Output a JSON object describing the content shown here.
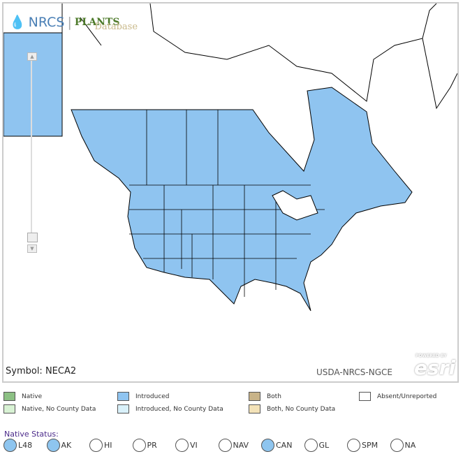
{
  "branding": {
    "agency": "NRCS",
    "product": "PLANTS",
    "product_sub": "Database"
  },
  "map": {
    "symbol_label": "Symbol: NECA2",
    "credit": "USDA-NRCS-NGCE",
    "esri_powered": "POWERED BY",
    "esri": "esri",
    "introduced_color": "#8fc4f0"
  },
  "legend": [
    {
      "label": "Native",
      "color": "#8cc084"
    },
    {
      "label": "Native, No County Data",
      "color": "#d8f2d4"
    },
    {
      "label": "Introduced",
      "color": "#8fc4f0"
    },
    {
      "label": "Introduced, No County Data",
      "color": "#d9f1fa"
    },
    {
      "label": "Both",
      "color": "#c8b388"
    },
    {
      "label": "Both, No County Data",
      "color": "#f3e2b8"
    },
    {
      "label": "Absent/Unreported",
      "color": "#ffffff"
    }
  ],
  "native_status": {
    "label": "Native Status:",
    "options": [
      {
        "code": "L48",
        "checked": true
      },
      {
        "code": "AK",
        "checked": true
      },
      {
        "code": "HI",
        "checked": false
      },
      {
        "code": "PR",
        "checked": false
      },
      {
        "code": "VI",
        "checked": false
      },
      {
        "code": "NAV",
        "checked": false
      },
      {
        "code": "CAN",
        "checked": true
      },
      {
        "code": "GL",
        "checked": false
      },
      {
        "code": "SPM",
        "checked": false
      },
      {
        "code": "NA",
        "checked": false
      }
    ]
  }
}
